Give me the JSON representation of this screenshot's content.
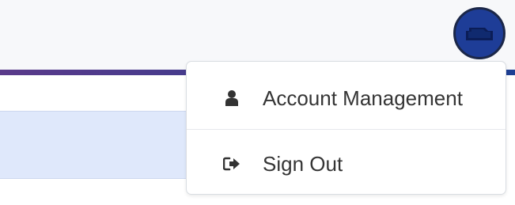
{
  "header": {
    "avatar_icon": "user-avatar-icon"
  },
  "dropdown": {
    "items": [
      {
        "label": "Account Management",
        "icon": "user-icon"
      },
      {
        "label": "Sign Out",
        "icon": "sign-out-icon"
      }
    ]
  },
  "colors": {
    "header_background": "#f7f8fa",
    "accent_start": "#5a3a8a",
    "accent_end": "#1d3f93",
    "avatar_background": "#1e3d97",
    "menu_text": "#353535",
    "panel_background": "#dfe8fb"
  }
}
